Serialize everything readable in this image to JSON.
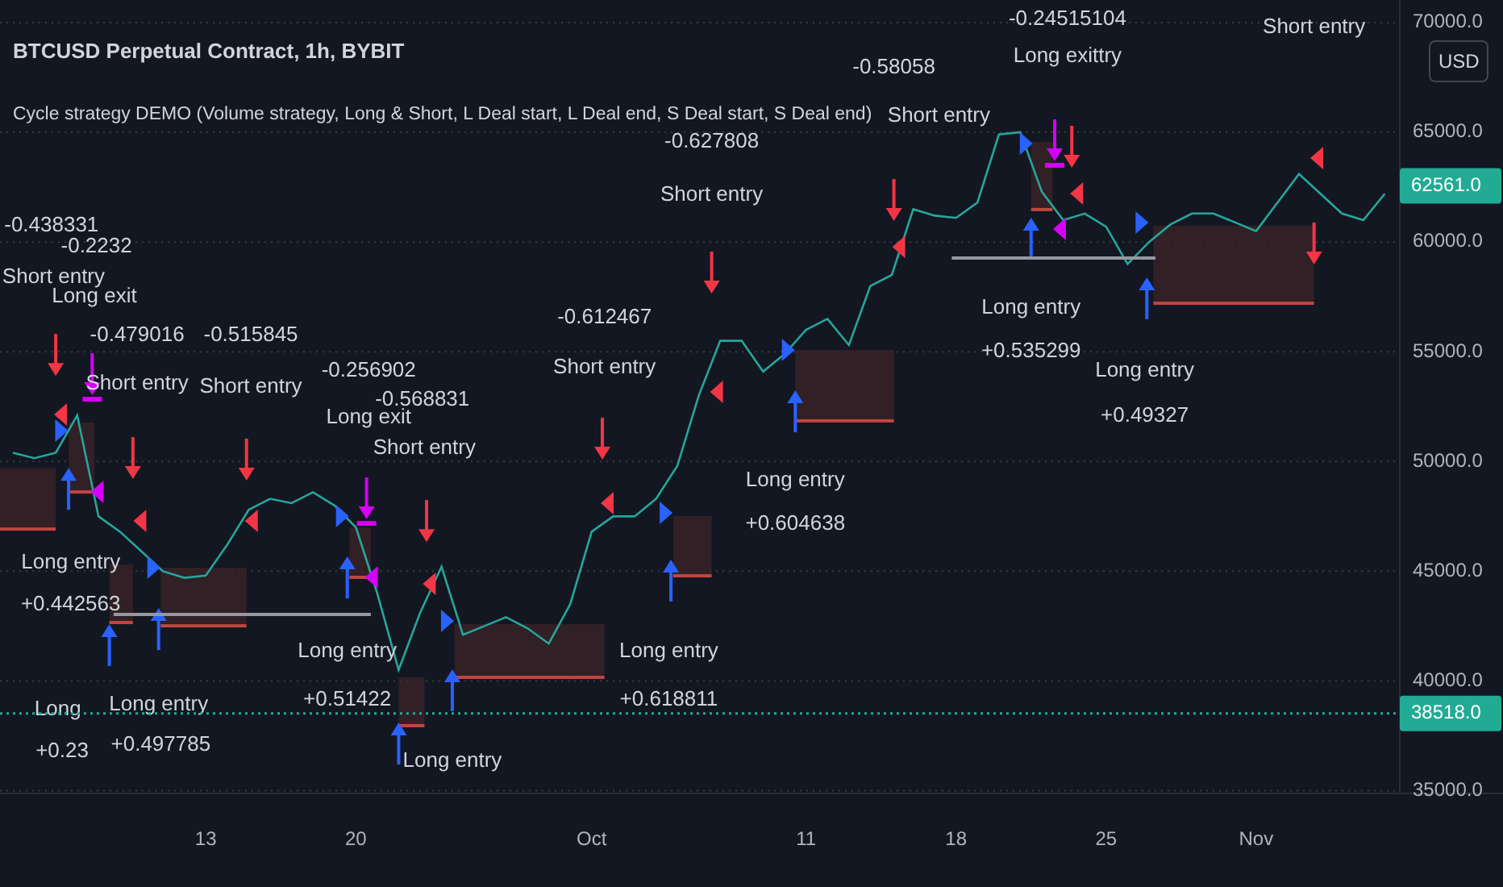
{
  "header": {
    "title": "BTCUSD Perpetual Contract, 1h, BYBIT",
    "subtitle": "Cycle strategy DEMO (Volume strategy, Long & Short, L Deal start, L Deal end, S Deal start, S Deal end)"
  },
  "currency_button": {
    "label": "USD"
  },
  "price_badges": [
    {
      "text": "62561.0"
    },
    {
      "text": "38518.0"
    }
  ],
  "chart_data": {
    "type": "line",
    "categories": [
      null,
      null,
      null,
      null,
      null,
      null,
      null,
      null,
      null,
      "13",
      null,
      null,
      null,
      null,
      null,
      null,
      "20",
      null,
      null,
      null,
      null,
      null,
      null,
      null,
      null,
      null,
      null,
      "Oct",
      null,
      null,
      null,
      null,
      null,
      null,
      null,
      null,
      null,
      "11",
      null,
      null,
      null,
      null,
      null,
      null,
      "18",
      null,
      null,
      null,
      null,
      null,
      null,
      "25",
      null,
      null,
      null,
      null,
      null,
      null,
      "Nov",
      null,
      null,
      null,
      null,
      null,
      null
    ],
    "series": [
      {
        "color": "#26a69a",
        "values": [
          50400,
          50150,
          50400,
          52100,
          47500,
          46800,
          45900,
          45000,
          44700,
          44800,
          46200,
          47800,
          48300,
          48100,
          48600,
          48000,
          47000,
          44000,
          40500,
          43100,
          45200,
          42100,
          42500,
          42900,
          42400,
          41700,
          43500,
          46800,
          47500,
          47500,
          48300,
          49800,
          53000,
          55500,
          55500,
          54100,
          54900,
          56000,
          56500,
          55300,
          58000,
          58500,
          61500,
          61200,
          61100,
          61800,
          64900,
          65000,
          62300,
          61000,
          61300,
          60700,
          59000,
          60000,
          60800,
          61300,
          61300,
          60900,
          60500,
          61800,
          63100,
          62200,
          61300,
          61000,
          62200
        ]
      }
    ],
    "ylim": [
      34870,
      71030
    ],
    "grid": true,
    "yticks": [
      {
        "value": 70000,
        "label": "70000.0"
      },
      {
        "value": 65000,
        "label": "65000.0"
      },
      {
        "value": 60000,
        "label": "60000.0"
      },
      {
        "value": 55000,
        "label": "55000.0"
      },
      {
        "value": 50000,
        "label": "50000.0"
      },
      {
        "value": 45000,
        "label": "45000.0"
      },
      {
        "value": 40000,
        "label": "40000.0"
      },
      {
        "value": 35000,
        "label": "35000.0"
      }
    ],
    "annotations": [
      "-0.438331",
      "-0.2232",
      "Short entry",
      "Long exit",
      "-0.479016",
      "Short entry",
      "-0.515845",
      "Short entry",
      "-0.256902",
      "-0.568831",
      "Long exit",
      "Short entry",
      "-0.612467",
      "Short entry",
      "-0.627808",
      "Short entry",
      "-0.58058",
      "Short entry",
      "-0.24515104",
      "Long exittry",
      "Short entry",
      "Long entry",
      "+0.442563",
      "Long",
      "+0.23",
      "Long entry",
      "+0.497785",
      "Long entry",
      "+0.51422",
      "Long entry",
      "Long entry",
      "+0.618811",
      "Long entry",
      "+0.604638",
      "Long entry",
      "+0.535299",
      "Long entry",
      "+0.49327"
    ]
  }
}
